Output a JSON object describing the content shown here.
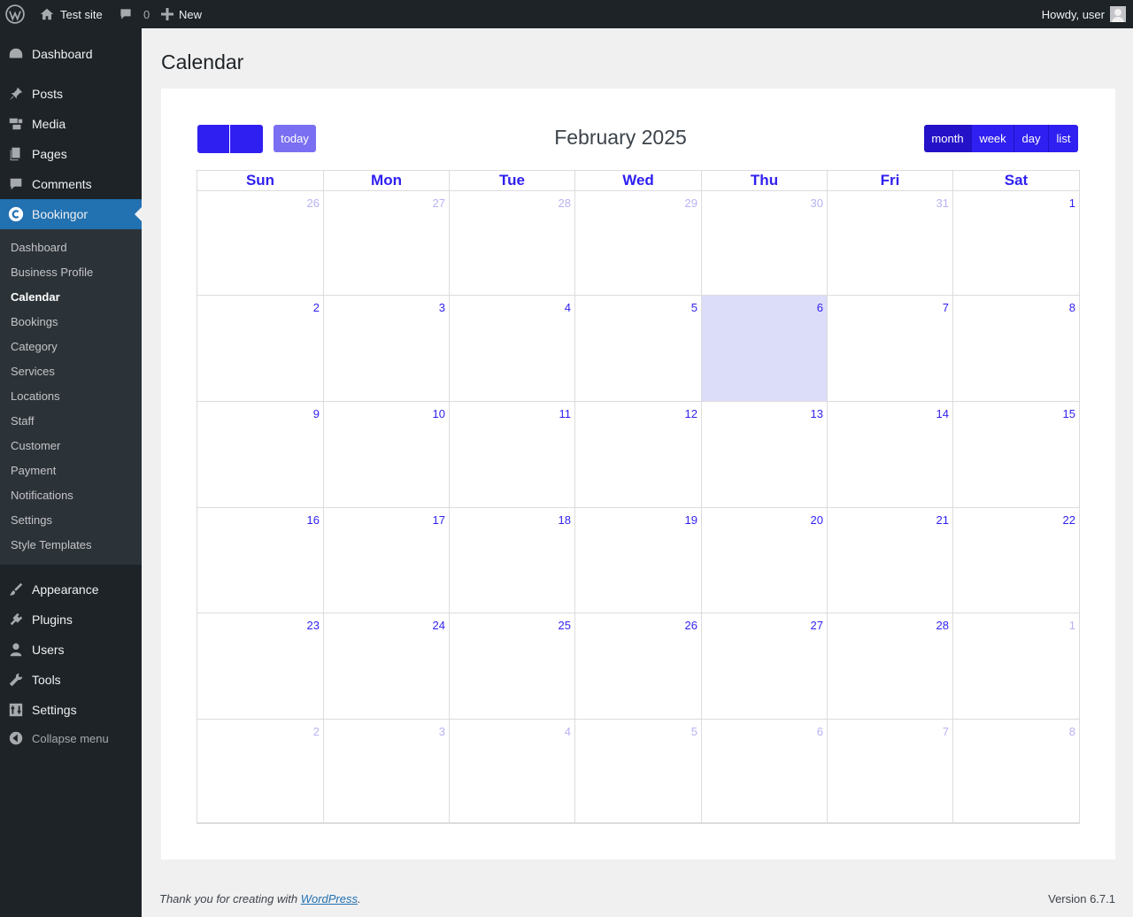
{
  "adminbar": {
    "site_name": "Test site",
    "comment_count": "0",
    "new_label": "New",
    "howdy": "Howdy, user"
  },
  "sidebar": {
    "items": [
      {
        "label": "Dashboard",
        "icon": "dashboard-icon"
      },
      {
        "label": "Posts",
        "icon": "pin-icon"
      },
      {
        "label": "Media",
        "icon": "media-icon"
      },
      {
        "label": "Pages",
        "icon": "pages-icon"
      },
      {
        "label": "Comments",
        "icon": "comment-icon"
      },
      {
        "label": "Bookingor",
        "icon": "bookingor-icon",
        "current": true
      },
      {
        "label": "Appearance",
        "icon": "brush-icon"
      },
      {
        "label": "Plugins",
        "icon": "plug-icon"
      },
      {
        "label": "Users",
        "icon": "user-icon"
      },
      {
        "label": "Tools",
        "icon": "wrench-icon"
      },
      {
        "label": "Settings",
        "icon": "settings-icon"
      }
    ],
    "submenu": [
      "Dashboard",
      "Business Profile",
      "Calendar",
      "Bookings",
      "Category",
      "Services",
      "Locations",
      "Staff",
      "Customer",
      "Payment",
      "Notifications",
      "Settings",
      "Style Templates"
    ],
    "submenu_current": "Calendar",
    "collapse_label": "Collapse menu"
  },
  "page": {
    "title": "Calendar"
  },
  "calendar": {
    "title": "February 2025",
    "today_label": "today",
    "views": [
      "month",
      "week",
      "day",
      "list"
    ],
    "active_view": "month",
    "weekdays": [
      "Sun",
      "Mon",
      "Tue",
      "Wed",
      "Thu",
      "Fri",
      "Sat"
    ],
    "weeks": [
      [
        "26",
        "27",
        "28",
        "29",
        "30",
        "31",
        "1"
      ],
      [
        "2",
        "3",
        "4",
        "5",
        "6",
        "7",
        "8"
      ],
      [
        "9",
        "10",
        "11",
        "12",
        "13",
        "14",
        "15"
      ],
      [
        "16",
        "17",
        "18",
        "19",
        "20",
        "21",
        "22"
      ],
      [
        "23",
        "24",
        "25",
        "26",
        "27",
        "28",
        "1"
      ],
      [
        "2",
        "3",
        "4",
        "5",
        "6",
        "7",
        "8"
      ]
    ],
    "today_date": "6",
    "colors": {
      "accent": "#2f1ff0",
      "today_bg": "#dcddf9",
      "other_month": "#b7b2f5"
    }
  },
  "footer": {
    "thanks_prefix": "Thank you for creating with ",
    "thanks_link": "WordPress",
    "thanks_suffix": ".",
    "version": "Version 6.7.1"
  }
}
